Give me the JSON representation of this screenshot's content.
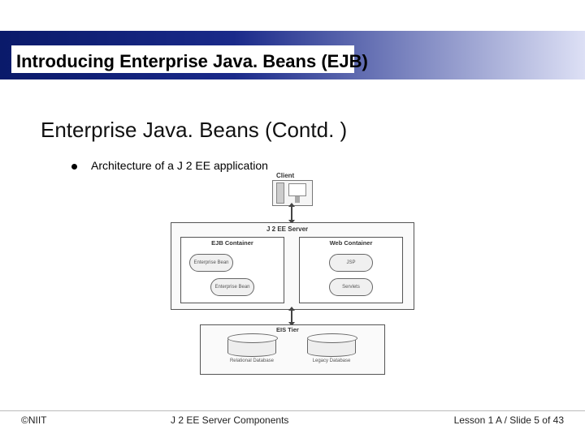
{
  "header": {
    "title": "Introducing Enterprise Java. Beans (EJB)"
  },
  "subtitle": "Enterprise Java. Beans (Contd. )",
  "bullet": "Architecture of a J 2 EE application",
  "diagram": {
    "client_label": "Client",
    "server_label": "J 2 EE Server",
    "ejb_container": {
      "label": "EJB Container",
      "bean1": "Enterprise Bean",
      "bean2": "Enterprise Bean"
    },
    "web_container": {
      "label": "Web Container",
      "item1": "JSP",
      "item2": "Servlets"
    },
    "eis_label": "EIS Tier",
    "db1": "Relational Database",
    "db2": "Legacy Database"
  },
  "footer": {
    "left": "©NIIT",
    "middle": "J 2 EE Server Components",
    "right": "Lesson 1 A / Slide 5 of 43"
  }
}
